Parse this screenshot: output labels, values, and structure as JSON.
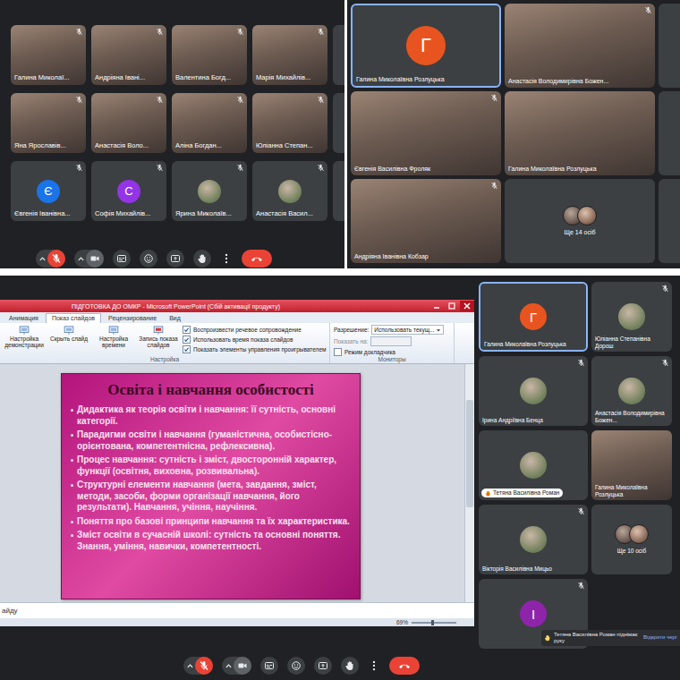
{
  "call_grid_left": {
    "mic_muted": true,
    "tiles": [
      {
        "name": "Галина Миколаї...",
        "kind": "video",
        "muted": true,
        "selected": false,
        "hand_raised": false
      },
      {
        "name": "Андріяна Івані...",
        "kind": "video",
        "muted": true,
        "selected": false,
        "hand_raised": false
      },
      {
        "name": "Валентина Богд...",
        "kind": "video",
        "muted": true,
        "selected": false,
        "hand_raised": false
      },
      {
        "name": "Марія Михайлів...",
        "kind": "video",
        "muted": true,
        "selected": false,
        "hand_raised": false
      },
      {
        "name": "Яна Ярославів...",
        "kind": "video",
        "muted": true,
        "selected": false,
        "hand_raised": false
      },
      {
        "name": "Анастасія Воло...",
        "kind": "video",
        "muted": true,
        "selected": false,
        "hand_raised": false
      },
      {
        "name": "Аліна Богдан...",
        "kind": "video",
        "muted": true,
        "selected": false,
        "hand_raised": false
      },
      {
        "name": "Юліанна Степан...",
        "kind": "video",
        "muted": true,
        "selected": false,
        "hand_raised": false
      },
      {
        "name": "Євгенія Іванівна...",
        "kind": "avatar",
        "initial": "Є",
        "color": "#1a73e8",
        "muted": true,
        "selected": false,
        "hand_raised": false
      },
      {
        "name": "Софія Михайлів...",
        "kind": "avatar",
        "initial": "С",
        "color": "#9334e6",
        "muted": true,
        "selected": false,
        "hand_raised": false
      },
      {
        "name": "Ярина Миколаїв...",
        "kind": "photo",
        "muted": true,
        "selected": false,
        "hand_raised": false
      },
      {
        "name": "Анастасія Васил...",
        "kind": "photo",
        "muted": true,
        "selected": false,
        "hand_raised": false
      }
    ]
  },
  "call_grid_right": {
    "tiles": [
      {
        "name": "Галина Миколаївна Розлуцька",
        "kind": "avatar",
        "initial": "Г",
        "color": "#e8541f",
        "muted": false,
        "selected": true,
        "hand_raised": false
      },
      {
        "name": "Анастасія Володимирівна Божен...",
        "kind": "video",
        "muted": true,
        "selected": false,
        "hand_raised": false
      },
      {
        "name": "Євгенія Василівна Фроляк",
        "kind": "video",
        "muted": true,
        "selected": false,
        "hand_raised": false
      },
      {
        "name": "Галина Миколаївна Розлуцька",
        "kind": "video",
        "muted": false,
        "selected": false,
        "hand_raised": false
      },
      {
        "name": "Андріяна Іванівна Кобзар",
        "kind": "video",
        "muted": true,
        "selected": false,
        "hand_raised": false
      },
      {
        "name": "Ще 14 осіб",
        "kind": "more",
        "muted": false,
        "selected": false,
        "hand_raised": false
      }
    ]
  },
  "presentation": {
    "window_title": "ПІДГОТОВКА ДО ОМКР - Microsoft PowerPoint (Сбій активації продукту)",
    "tabs": [
      {
        "label": "Анимация",
        "selected": false
      },
      {
        "label": "Показ слайдов",
        "selected": true
      },
      {
        "label": "Рецензирование",
        "selected": false
      },
      {
        "label": "Вид",
        "selected": false
      }
    ],
    "ribbon_buttons": [
      "Настройка демонстрации",
      "Скрыть слайд",
      "Настройка времени",
      "Запись показа слайдов"
    ],
    "options": [
      {
        "label": "Воспроизвести речевое сопровождение",
        "checked": true
      },
      {
        "label": "Использовать время показа слайдов",
        "checked": true
      },
      {
        "label": "Показать элементы управления проигрывателем",
        "checked": true
      }
    ],
    "setup_group": "Настройка",
    "monitors": {
      "resolution_label": "Разрешение:",
      "resolution_value": "Использовать текущ...",
      "show_on_label": "Показать на:",
      "show_on_disabled": true,
      "presenter_view": {
        "label": "Режим докладчика",
        "checked": false
      },
      "group": "Мониторы"
    },
    "slide": {
      "title": "Освіта і навчання особистості",
      "bullets": [
        "Дидактика як теорія освіти і навчання: її сутність, основні категорії.",
        "Парадигми освіти і навчання (гуманістична, особистісно-орієнтована, компетентнісна, рефлексивна).",
        "Процес навчання: сутність і зміст, двосторонній характер, функції (освітня, виховна, розвивальна).",
        "Структурні елементи навчання (мета, завдання, зміст, методи, засоби, форми організації навчання, його результати). Навчання, учіння, научіння.",
        "Поняття про базові принципи навчання та їх характеристика.",
        "Зміст освіти в сучасній школі: сутність та основні поняття. Знання, уміння, навички, компетентності."
      ]
    },
    "notes_text": "айду",
    "zoom": "69%"
  },
  "call_grid_bottom": {
    "mic_muted": true,
    "tiles": [
      {
        "name": "Галина Миколаївна Розлуцька",
        "kind": "avatar",
        "initial": "Г",
        "color": "#e8541f",
        "muted": false,
        "selected": true,
        "hand_raised": false
      },
      {
        "name": "Юліанна Степанівна Дорош",
        "kind": "photo",
        "muted": true,
        "selected": false,
        "hand_raised": false
      },
      {
        "name": "Ірина Андріївна Бенца",
        "kind": "photo",
        "muted": true,
        "selected": false,
        "hand_raised": false
      },
      {
        "name": "Анастасія Володимирівна Божен...",
        "kind": "photo",
        "muted": true,
        "selected": false,
        "hand_raised": false
      },
      {
        "name": "Тетяна Василівна Роман",
        "kind": "photo",
        "muted": false,
        "selected": false,
        "hand_raised": true
      },
      {
        "name": "Галина Миколаївна Розлуцька",
        "kind": "video",
        "muted": false,
        "selected": false,
        "hand_raised": false
      },
      {
        "name": "Вікторія Василівна Мицьо",
        "kind": "photo",
        "muted": true,
        "selected": false,
        "hand_raised": false
      },
      {
        "name": "Ще 10 осіб",
        "kind": "more",
        "muted": false,
        "selected": false,
        "hand_raised": false
      },
      {
        "kind": "avatar",
        "initial": "І",
        "color": "#8e24aa",
        "muted": true,
        "selected": false,
        "hand_raised": false
      }
    ]
  },
  "notification": {
    "text": "Тетяна Василівна Роман піднімає руку",
    "action": "Відкрити черг"
  }
}
